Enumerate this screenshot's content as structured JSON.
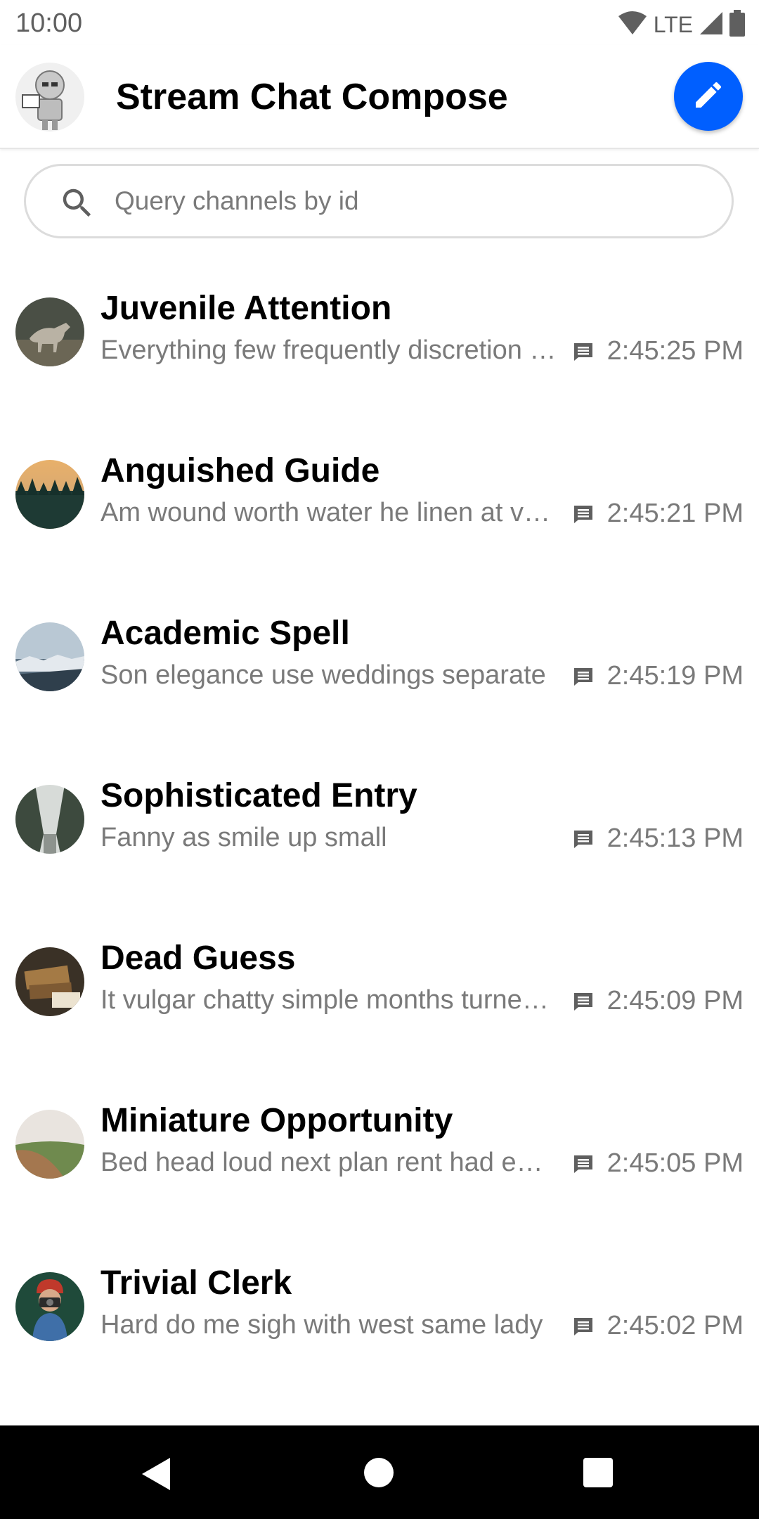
{
  "status_bar": {
    "time": "10:00",
    "network_label": "LTE",
    "icons": [
      "wifi-icon",
      "signal-icon",
      "battery-icon"
    ]
  },
  "header": {
    "title": "Stream Chat Compose",
    "avatar_icon": "user-avatar",
    "compose_icon": "pencil-icon",
    "accent_color": "#005fff"
  },
  "search": {
    "placeholder": "Query channels by id",
    "value": ""
  },
  "channels": [
    {
      "name": "Juvenile Attention",
      "preview": "Everything few frequently discretion …",
      "time": "2:45:25 PM",
      "avatar": "wolf"
    },
    {
      "name": "Anguished Guide",
      "preview": "Am wound worth water he linen at ve…",
      "time": "2:45:21 PM",
      "avatar": "forest-sunset"
    },
    {
      "name": "Academic Spell",
      "preview": "Son elegance use weddings separate",
      "time": "2:45:19 PM",
      "avatar": "snowy-town"
    },
    {
      "name": "Sophisticated Entry",
      "preview": "Fanny as smile up small",
      "time": "2:45:13 PM",
      "avatar": "misty-trees"
    },
    {
      "name": "Dead Guess",
      "preview": "It vulgar chatty simple months turned…",
      "time": "2:45:09 PM",
      "avatar": "books"
    },
    {
      "name": "Miniature Opportunity",
      "preview": "Bed head loud next plan rent had eas…",
      "time": "2:45:05 PM",
      "avatar": "field"
    },
    {
      "name": "Trivial Clerk",
      "preview": "Hard do me sigh with west same lady",
      "time": "2:45:02 PM",
      "avatar": "photographer"
    }
  ],
  "nav": {
    "items": [
      "back-icon",
      "home-icon",
      "recents-icon"
    ]
  }
}
